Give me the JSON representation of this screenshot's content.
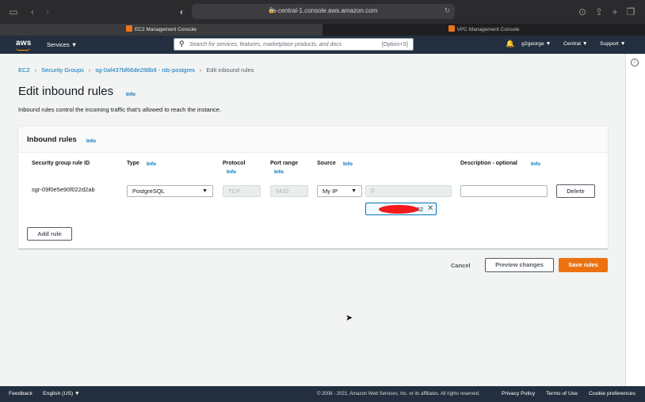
{
  "browser": {
    "url": "ca-central-1.console.aws.amazon.com",
    "tabs": [
      {
        "label": "EC2 Management Console",
        "active": true
      },
      {
        "label": "VPC Management Console",
        "active": false
      }
    ]
  },
  "nav": {
    "logo": "aws",
    "services_label": "Services",
    "search_placeholder": "Search for services, features, marketplace products, and docs",
    "search_shortcut": "[Option+S]",
    "user": "g2george",
    "region": "Central",
    "support": "Support"
  },
  "breadcrumb": {
    "items": [
      "EC2",
      "Security Groups",
      "sg-0af437bf66de288b9 - rds-postgres"
    ],
    "current": "Edit inbound rules"
  },
  "page": {
    "title": "Edit inbound rules",
    "info": "Info",
    "description": "Inbound rules control the incoming traffic that's allowed to reach the instance."
  },
  "panel": {
    "title": "Inbound rules",
    "info": "Info",
    "columns": {
      "rule_id": "Security group rule ID",
      "type": "Type",
      "protocol": "Protocol",
      "port_range": "Port range",
      "source": "Source",
      "description": "Description - optional"
    },
    "info_label": "Info",
    "rule": {
      "id": "sgr-09f0e5e90f022d2ab",
      "type": "PostgreSQL",
      "protocol": "TCP",
      "port_range": "5432",
      "source": "My IP",
      "source_token_suffix": "32",
      "delete_label": "Delete"
    },
    "add_rule_label": "Add rule"
  },
  "actions": {
    "cancel": "Cancel",
    "preview": "Preview changes",
    "save": "Save rules"
  },
  "footer": {
    "feedback": "Feedback",
    "language": "English (US)",
    "copyright": "© 2008 - 2021, Amazon Web Services, Inc. or its affiliates. All rights reserved.",
    "privacy": "Privacy Policy",
    "terms": "Terms of Use",
    "cookies": "Cookie preferences"
  },
  "colors": {
    "nav_bg": "#232f3e",
    "link": "#0073bb",
    "primary": "#ec7211",
    "redaction": "#f21a1a"
  }
}
